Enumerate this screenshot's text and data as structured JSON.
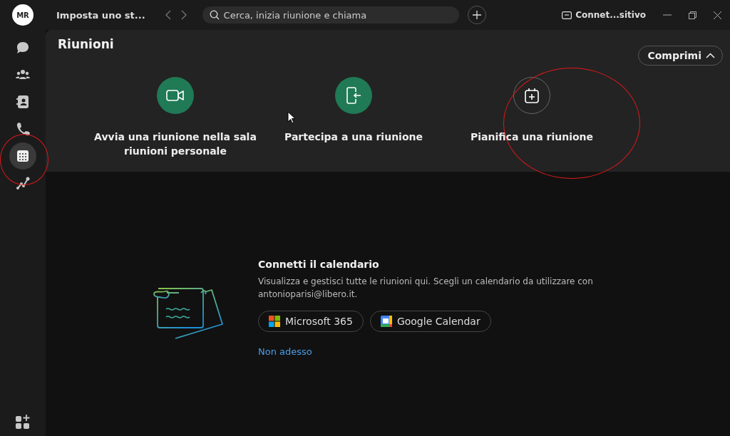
{
  "top_bar": {
    "avatar": "MR",
    "title": "Imposta uno st...",
    "search": {
      "placeholder": "Cerca, inizia riunione e chiama"
    },
    "device": "Connet...sitivo"
  },
  "sidebar": {
    "items": [
      {
        "kind": "chat",
        "selected": false
      },
      {
        "kind": "people",
        "selected": false
      },
      {
        "kind": "contacts",
        "selected": false
      },
      {
        "kind": "phone",
        "selected": false
      },
      {
        "kind": "calendar",
        "selected": true
      },
      {
        "kind": "graph",
        "selected": false
      }
    ]
  },
  "meetings": {
    "title": "Riunioni",
    "collapse_button": "Comprimi",
    "actions": [
      {
        "kind": "video",
        "label": "Avvia una riunione nella sala riunioni personale"
      },
      {
        "kind": "join",
        "label": "Partecipa a una riunione"
      },
      {
        "kind": "schedule",
        "label": "Pianifica una riunione"
      }
    ]
  },
  "calendar_connect": {
    "title": "Connetti il calendario",
    "description": "Visualizza e gestisci tutte le riunioni qui. Scegli un calendario da utilizzare con antonioparisi@libero.it.",
    "buttons": [
      {
        "kind": "microsoft",
        "label": "Microsoft 365"
      },
      {
        "kind": "google",
        "label": "Google Calendar"
      }
    ],
    "link": "Non adesso"
  }
}
